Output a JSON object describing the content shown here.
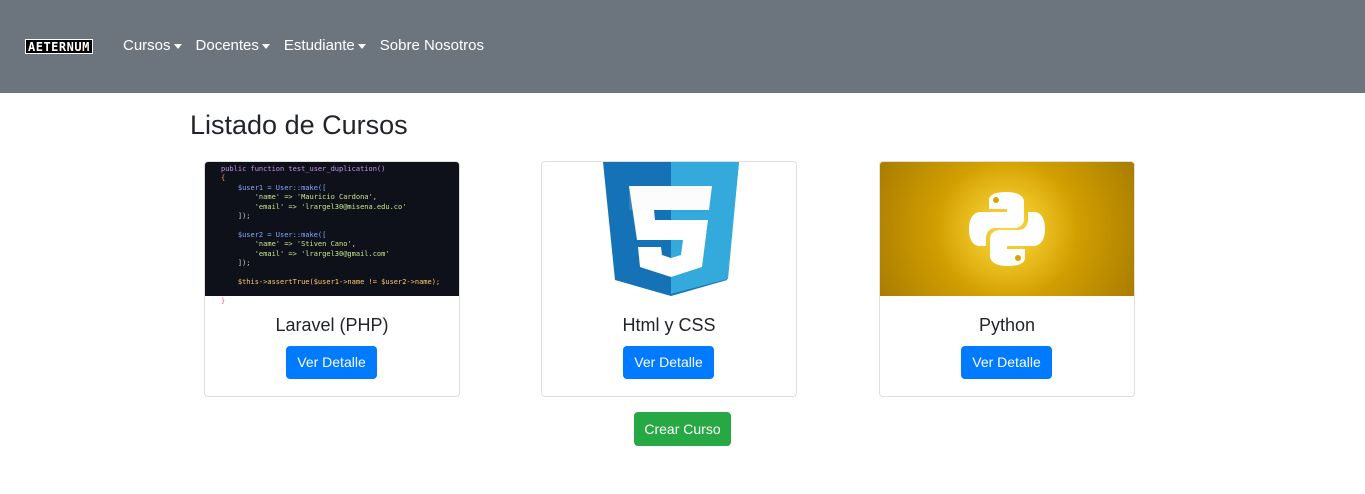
{
  "navbar": {
    "brand": "AETERNUM",
    "items": [
      {
        "label": "Cursos",
        "dropdown": true
      },
      {
        "label": "Docentes",
        "dropdown": true
      },
      {
        "label": "Estudiante",
        "dropdown": true
      },
      {
        "label": "Sobre Nosotros",
        "dropdown": false
      }
    ]
  },
  "main": {
    "title": "Listado de Cursos",
    "cards": [
      {
        "title": "Laravel (PHP)",
        "button": "Ver Detalle",
        "image": "php-code-screenshot"
      },
      {
        "title": "Html y CSS",
        "button": "Ver Detalle",
        "image": "css3-logo"
      },
      {
        "title": "Python",
        "button": "Ver Detalle",
        "image": "python-logo"
      }
    ],
    "create_button": "Crear Curso",
    "code_lines": [
      "public function test_user_duplication()",
      "{",
      "    $user1 = User::make([",
      "        'name' => 'Mauricio Cardona',",
      "        'email' => 'lrargel30@misena.edu.co'",
      "    ]);",
      "    $user2 = User::make([",
      "        'name' => 'Stiven Cano',",
      "        'email' => 'lrargel30@gmail.com'",
      "    ]);",
      "    $this->assertTrue($user1->name != $user2->name);",
      "}"
    ]
  },
  "colors": {
    "navbar": "#6c757d",
    "primary": "#007bff",
    "success": "#28a745",
    "css_blue": "#2965f1",
    "python_bg": "#d8a500"
  }
}
